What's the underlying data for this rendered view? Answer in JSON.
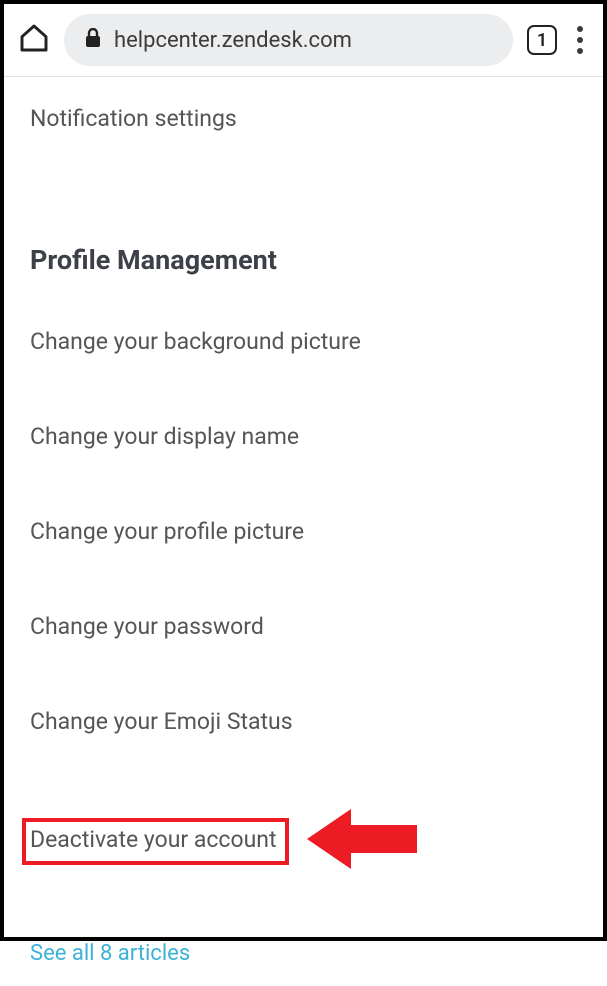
{
  "browser": {
    "url": "helpcenter.zendesk.com",
    "tab_count": "1"
  },
  "article0": "Notification settings",
  "section_heading": "Profile Management",
  "articles": [
    "Change your background picture",
    "Change your display name",
    "Change your profile picture",
    "Change your password",
    "Change your Emoji Status"
  ],
  "highlight_article": "Deactivate your account",
  "see_all": "See all 8 articles"
}
